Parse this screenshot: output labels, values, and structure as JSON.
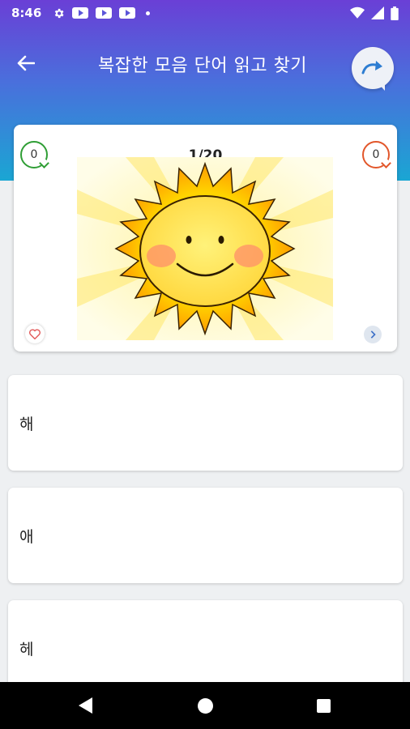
{
  "status_bar": {
    "time": "8:46",
    "icons": [
      "gear-icon",
      "youtube-icon",
      "youtube-icon",
      "youtube-icon",
      "dot-icon",
      "wifi-icon",
      "signal-icon",
      "battery-icon"
    ]
  },
  "app_bar": {
    "title": "복잡한 모음 단어 읽고 찾기",
    "back_icon": "arrow-left-icon",
    "share_icon": "share-forward-icon"
  },
  "quiz_card": {
    "correct_count": "0",
    "wrong_count": "0",
    "progress": "1/20",
    "picture": "sun-illustration",
    "favorite_icon": "heart-icon",
    "next_icon": "chevron-right-icon"
  },
  "answers": [
    {
      "text": "해"
    },
    {
      "text": "애"
    },
    {
      "text": "헤"
    }
  ],
  "colors": {
    "header_top": "#6a3fd6",
    "header_bottom": "#1aa6d3",
    "correct": "#2f9e35",
    "wrong": "#e2562a",
    "background": "#eef0f2"
  },
  "nav_bar": {
    "icons": [
      "back-triangle-icon",
      "home-circle-icon",
      "recents-square-icon"
    ]
  }
}
